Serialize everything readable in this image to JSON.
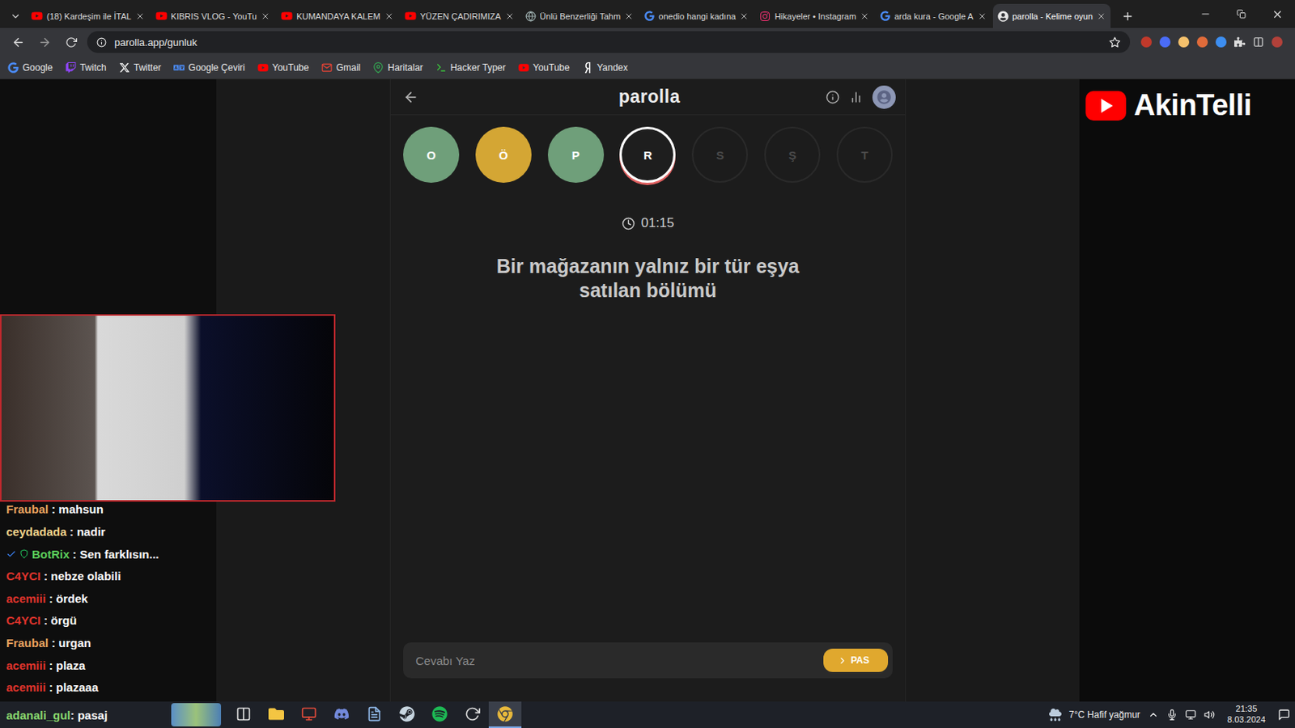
{
  "browser": {
    "tabs": [
      {
        "label": "(18) Kardeşim ile İTAL",
        "kind": "youtube",
        "selected": false
      },
      {
        "label": "KIBRIS VLOG - YouTu",
        "kind": "youtube",
        "selected": false
      },
      {
        "label": "KUMANDAYA KALEM",
        "kind": "youtube",
        "selected": false
      },
      {
        "label": "YÜZEN ÇADIRIMIZA",
        "kind": "youtube",
        "selected": false
      },
      {
        "label": "Ünlü Benzerliği Tahm",
        "kind": "site",
        "selected": false
      },
      {
        "label": "onedio hangi kadına",
        "kind": "google",
        "selected": false
      },
      {
        "label": "Hikayeler • Instagram",
        "kind": "instagram",
        "selected": false
      },
      {
        "label": "arda kura - Google A",
        "kind": "google",
        "selected": false
      },
      {
        "label": "parolla - Kelime oyun",
        "kind": "parolla",
        "selected": true
      }
    ],
    "address": "parolla.app/gunluk",
    "bookmarks": [
      {
        "label": "Google",
        "kind": "google"
      },
      {
        "label": "Twitch",
        "kind": "twitch"
      },
      {
        "label": "Twitter",
        "kind": "x"
      },
      {
        "label": "Google Çeviri",
        "kind": "translate"
      },
      {
        "label": "YouTube",
        "kind": "youtube"
      },
      {
        "label": "Gmail",
        "kind": "gmail"
      },
      {
        "label": "Haritalar",
        "kind": "maps"
      },
      {
        "label": "Hacker Typer",
        "kind": "terminal"
      },
      {
        "label": "YouTube",
        "kind": "youtube"
      },
      {
        "label": "Yandex",
        "kind": "yandex"
      }
    ]
  },
  "game": {
    "title": "parolla",
    "letters": [
      {
        "letter": "O",
        "kind": "correct",
        "color": "#6f9f7a"
      },
      {
        "letter": "Ö",
        "kind": "passed",
        "color": "#d4a634"
      },
      {
        "letter": "P",
        "kind": "correct",
        "color": "#6f9f7a"
      },
      {
        "letter": "R",
        "kind": "current",
        "color": "#1e1e1e"
      },
      {
        "letter": "S",
        "kind": "pending",
        "color": "#1c1c1c"
      },
      {
        "letter": "Ş",
        "kind": "pending",
        "color": "#1c1c1c"
      },
      {
        "letter": "T",
        "kind": "pending",
        "color": "#1c1c1c"
      }
    ],
    "timer": "01:15",
    "question": "Bir mağazanın yalnız bir tür eşya satılan bölümü",
    "input_placeholder": "Cevabı Yaz",
    "pass_button": "PAS"
  },
  "channel_logo": "AkinTelli",
  "chat": [
    {
      "user": "Fraubal",
      "message": ": mahsun",
      "color": "#e9a35f",
      "badges": false
    },
    {
      "user": "ceydadada",
      "message": ": nadir",
      "color": "#f1d38c",
      "badges": false
    },
    {
      "user": "BotRix",
      "message": ": Sen farklısın...",
      "color": "#5ccf5c",
      "badges": true
    },
    {
      "user": "C4YCI",
      "message": ": nebze olabili",
      "color": "#e0342c",
      "badges": false
    },
    {
      "user": "acemiii",
      "message": ": ördek",
      "color": "#e0342c",
      "badges": false
    },
    {
      "user": "C4YCI",
      "message": ": örgü",
      "color": "#e0342c",
      "badges": false
    },
    {
      "user": "Fraubal",
      "message": ": urgan",
      "color": "#e9a35f",
      "badges": false
    },
    {
      "user": "acemiii",
      "message": ": plaza",
      "color": "#e0342c",
      "badges": false
    },
    {
      "user": "acemiii",
      "message": ": plazaaa",
      "color": "#e0342c",
      "badges": false
    }
  ],
  "taskbar": {
    "chat_overlay": {
      "user": "adanali_gul",
      "message": ": pasaj",
      "color": "#8ad96f"
    },
    "apps": [
      {
        "kind": "taskview",
        "selected": false
      },
      {
        "kind": "explorer",
        "selected": false
      },
      {
        "kind": "voicemeeter",
        "selected": false
      },
      {
        "kind": "discord",
        "selected": false
      },
      {
        "kind": "notes",
        "selected": false
      },
      {
        "kind": "steam",
        "selected": false
      },
      {
        "kind": "spotify",
        "selected": false
      },
      {
        "kind": "obs",
        "selected": false
      },
      {
        "kind": "chrome",
        "selected": true
      }
    ],
    "weather": "7°C Hafif yağmur",
    "time": "21:35",
    "date": "8.03.2024"
  }
}
